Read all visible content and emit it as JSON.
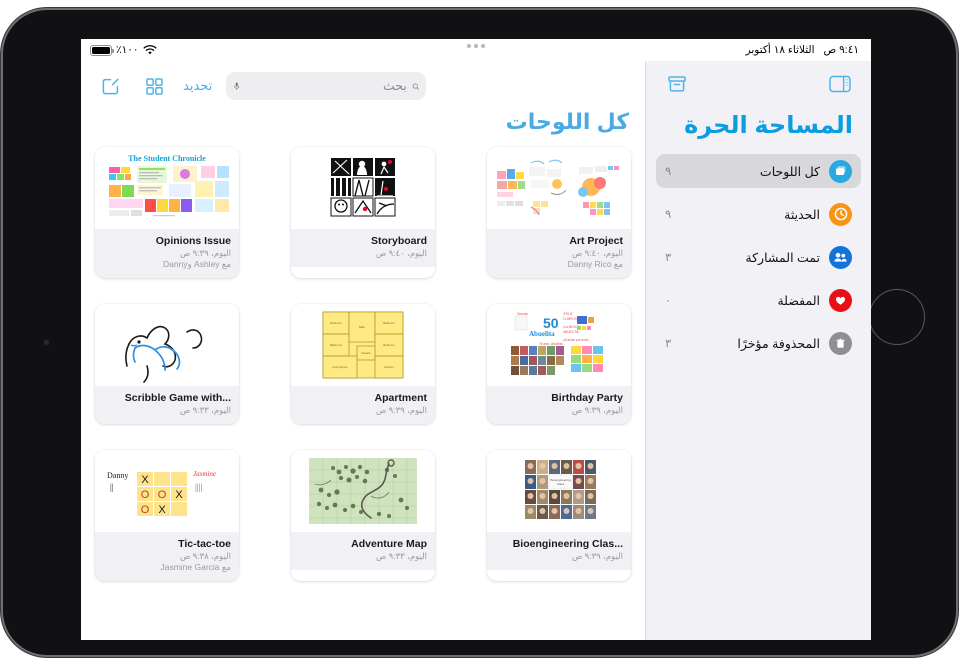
{
  "status_bar": {
    "battery_pct": "٪١٠٠",
    "time": "٩:٤١ ص",
    "date": "الثلاثاء ١٨ أكتوبر",
    "wifi_icon": "wifi-icon",
    "battery_icon": "battery-icon",
    "multitask_icon": "multitasking-dots-icon"
  },
  "sidebar": {
    "title": "المساحة الحرة",
    "archive_icon": "archive-box-icon",
    "toggle_icon": "sidebar-toggle-icon",
    "items": [
      {
        "label": "كل اللوحات",
        "count": "٩",
        "icon": "boards-stack-icon",
        "color": "#28a9e0",
        "selected": true
      },
      {
        "label": "الحديثة",
        "count": "٩",
        "icon": "clock-icon",
        "color": "#f79413",
        "selected": false
      },
      {
        "label": "تمت المشاركة",
        "count": "٣",
        "icon": "people-icon",
        "color": "#1273dc",
        "selected": false
      },
      {
        "label": "المفضلة",
        "count": "٠",
        "icon": "heart-icon",
        "color": "#ea0f15",
        "selected": false
      },
      {
        "label": "المحذوفة مؤخرًا",
        "count": "٣",
        "icon": "trash-icon",
        "color": "#8e8e93",
        "selected": false
      }
    ]
  },
  "main": {
    "title": "كل اللوحات",
    "new_board_icon": "compose-new-board-icon",
    "grid_view_icon": "grid-view-icon",
    "select_label": "تحديد",
    "search": {
      "placeholder": "بحث",
      "value": "",
      "search_icon": "magnifier-icon",
      "mic_icon": "microphone-icon"
    },
    "boards": [
      {
        "title": "Opinions Issue",
        "time": "اليوم، ٩:٣٩ ص",
        "shared": "مع Ashley وDanny",
        "art": "newspaper"
      },
      {
        "title": "Storyboard",
        "time": "اليوم، ٩:٤٠ ص",
        "shared": "",
        "art": "storyboard"
      },
      {
        "title": "Art Project",
        "time": "اليوم، ٩:٤٠ ص",
        "shared": "مع Danny Rico",
        "art": "artproject"
      },
      {
        "title": "Scribble Game with...",
        "time": "اليوم، ٩:٣٣ ص",
        "shared": "",
        "art": "scribble"
      },
      {
        "title": "Apartment",
        "time": "اليوم، ٩:٣٩ ص",
        "shared": "",
        "art": "floorplan"
      },
      {
        "title": "Birthday Party",
        "time": "اليوم، ٩:٣٩ ص",
        "shared": "",
        "art": "birthday"
      },
      {
        "title": "Tic-tac-toe",
        "time": "اليوم، ٩:٣٨ ص",
        "shared": "مع Jasmine Garcia",
        "art": "tictactoe"
      },
      {
        "title": "Adventure Map",
        "time": "اليوم، ٩:٣٣ ص",
        "shared": "",
        "art": "map"
      },
      {
        "title": "Bioengineering Clas...",
        "time": "اليوم، ٩:٣٩ ص",
        "shared": "",
        "art": "faces"
      }
    ]
  },
  "colors": {
    "accent": "#4aabe4",
    "sidebar_bg": "#f2f1f6",
    "caption_bg": "#f1f0f5"
  }
}
